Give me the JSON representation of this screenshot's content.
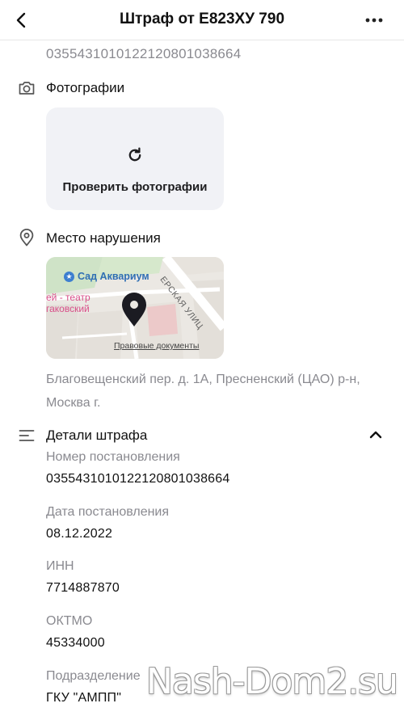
{
  "header": {
    "title": "Штраф от Е823ХУ 790",
    "back_icon": "chevron-left-icon",
    "more_icon": "more-horizontal-icon"
  },
  "top_number": "03554310101221208010386​64",
  "photos": {
    "title": "Фотографии",
    "icon": "camera-icon",
    "check_label": "Проверить фотографии",
    "check_icon": "refresh-icon"
  },
  "location": {
    "title": "Место нарушения",
    "icon": "location-pin-icon",
    "map": {
      "park_label": "Сад Аквариум",
      "theatre_line1": "ей - театр",
      "theatre_line2": "гаковский",
      "street_label": "ЕРСКАЯ УЛИЦ",
      "legal_link": "Правовые документы"
    },
    "address": "Благовещенский пер. д. 1А, Пресненский (ЦАО) р-н, Москва г."
  },
  "details": {
    "title": "Детали штрафа",
    "icon": "list-icon",
    "toggle_icon": "chevron-up-icon",
    "fields": [
      {
        "label": "Номер постановления",
        "value": "03554310101221208010386​64"
      },
      {
        "label": "Дата постановления",
        "value": "08.12.2022"
      },
      {
        "label": "ИНН",
        "value": "7714887870"
      },
      {
        "label": "ОКТМО",
        "value": "45334000"
      },
      {
        "label": "Подразделение",
        "value": "ГКУ \"АМПП\""
      }
    ]
  },
  "watermark": "Nash-Dom2.su",
  "colors": {
    "text_primary": "#111111",
    "text_secondary": "#8a8a90",
    "card_bg": "#f1f2f6",
    "divider": "#e6e6e6"
  }
}
